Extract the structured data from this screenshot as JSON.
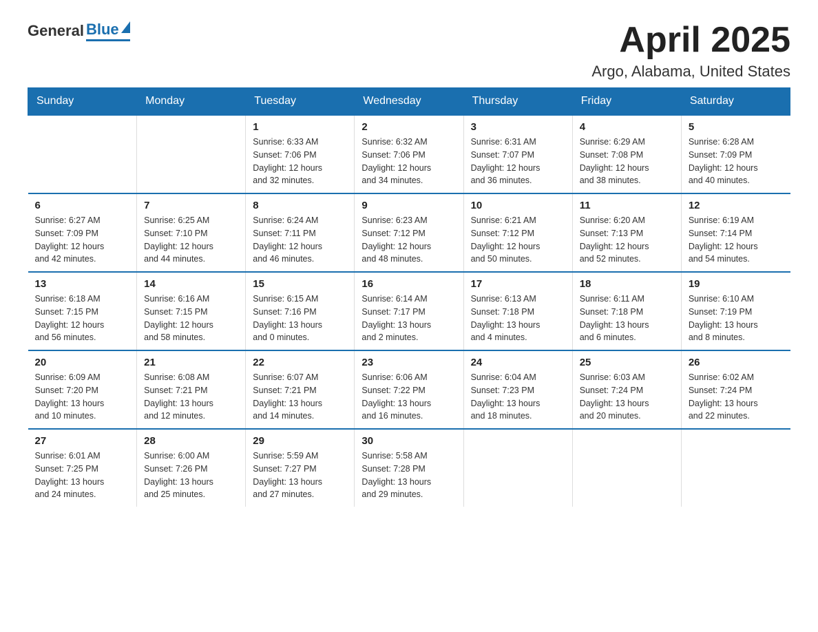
{
  "header": {
    "logo_general": "General",
    "logo_blue": "Blue",
    "month": "April 2025",
    "location": "Argo, Alabama, United States"
  },
  "days_of_week": [
    "Sunday",
    "Monday",
    "Tuesday",
    "Wednesday",
    "Thursday",
    "Friday",
    "Saturday"
  ],
  "weeks": [
    [
      {
        "day": "",
        "info": ""
      },
      {
        "day": "",
        "info": ""
      },
      {
        "day": "1",
        "info": "Sunrise: 6:33 AM\nSunset: 7:06 PM\nDaylight: 12 hours\nand 32 minutes."
      },
      {
        "day": "2",
        "info": "Sunrise: 6:32 AM\nSunset: 7:06 PM\nDaylight: 12 hours\nand 34 minutes."
      },
      {
        "day": "3",
        "info": "Sunrise: 6:31 AM\nSunset: 7:07 PM\nDaylight: 12 hours\nand 36 minutes."
      },
      {
        "day": "4",
        "info": "Sunrise: 6:29 AM\nSunset: 7:08 PM\nDaylight: 12 hours\nand 38 minutes."
      },
      {
        "day": "5",
        "info": "Sunrise: 6:28 AM\nSunset: 7:09 PM\nDaylight: 12 hours\nand 40 minutes."
      }
    ],
    [
      {
        "day": "6",
        "info": "Sunrise: 6:27 AM\nSunset: 7:09 PM\nDaylight: 12 hours\nand 42 minutes."
      },
      {
        "day": "7",
        "info": "Sunrise: 6:25 AM\nSunset: 7:10 PM\nDaylight: 12 hours\nand 44 minutes."
      },
      {
        "day": "8",
        "info": "Sunrise: 6:24 AM\nSunset: 7:11 PM\nDaylight: 12 hours\nand 46 minutes."
      },
      {
        "day": "9",
        "info": "Sunrise: 6:23 AM\nSunset: 7:12 PM\nDaylight: 12 hours\nand 48 minutes."
      },
      {
        "day": "10",
        "info": "Sunrise: 6:21 AM\nSunset: 7:12 PM\nDaylight: 12 hours\nand 50 minutes."
      },
      {
        "day": "11",
        "info": "Sunrise: 6:20 AM\nSunset: 7:13 PM\nDaylight: 12 hours\nand 52 minutes."
      },
      {
        "day": "12",
        "info": "Sunrise: 6:19 AM\nSunset: 7:14 PM\nDaylight: 12 hours\nand 54 minutes."
      }
    ],
    [
      {
        "day": "13",
        "info": "Sunrise: 6:18 AM\nSunset: 7:15 PM\nDaylight: 12 hours\nand 56 minutes."
      },
      {
        "day": "14",
        "info": "Sunrise: 6:16 AM\nSunset: 7:15 PM\nDaylight: 12 hours\nand 58 minutes."
      },
      {
        "day": "15",
        "info": "Sunrise: 6:15 AM\nSunset: 7:16 PM\nDaylight: 13 hours\nand 0 minutes."
      },
      {
        "day": "16",
        "info": "Sunrise: 6:14 AM\nSunset: 7:17 PM\nDaylight: 13 hours\nand 2 minutes."
      },
      {
        "day": "17",
        "info": "Sunrise: 6:13 AM\nSunset: 7:18 PM\nDaylight: 13 hours\nand 4 minutes."
      },
      {
        "day": "18",
        "info": "Sunrise: 6:11 AM\nSunset: 7:18 PM\nDaylight: 13 hours\nand 6 minutes."
      },
      {
        "day": "19",
        "info": "Sunrise: 6:10 AM\nSunset: 7:19 PM\nDaylight: 13 hours\nand 8 minutes."
      }
    ],
    [
      {
        "day": "20",
        "info": "Sunrise: 6:09 AM\nSunset: 7:20 PM\nDaylight: 13 hours\nand 10 minutes."
      },
      {
        "day": "21",
        "info": "Sunrise: 6:08 AM\nSunset: 7:21 PM\nDaylight: 13 hours\nand 12 minutes."
      },
      {
        "day": "22",
        "info": "Sunrise: 6:07 AM\nSunset: 7:21 PM\nDaylight: 13 hours\nand 14 minutes."
      },
      {
        "day": "23",
        "info": "Sunrise: 6:06 AM\nSunset: 7:22 PM\nDaylight: 13 hours\nand 16 minutes."
      },
      {
        "day": "24",
        "info": "Sunrise: 6:04 AM\nSunset: 7:23 PM\nDaylight: 13 hours\nand 18 minutes."
      },
      {
        "day": "25",
        "info": "Sunrise: 6:03 AM\nSunset: 7:24 PM\nDaylight: 13 hours\nand 20 minutes."
      },
      {
        "day": "26",
        "info": "Sunrise: 6:02 AM\nSunset: 7:24 PM\nDaylight: 13 hours\nand 22 minutes."
      }
    ],
    [
      {
        "day": "27",
        "info": "Sunrise: 6:01 AM\nSunset: 7:25 PM\nDaylight: 13 hours\nand 24 minutes."
      },
      {
        "day": "28",
        "info": "Sunrise: 6:00 AM\nSunset: 7:26 PM\nDaylight: 13 hours\nand 25 minutes."
      },
      {
        "day": "29",
        "info": "Sunrise: 5:59 AM\nSunset: 7:27 PM\nDaylight: 13 hours\nand 27 minutes."
      },
      {
        "day": "30",
        "info": "Sunrise: 5:58 AM\nSunset: 7:28 PM\nDaylight: 13 hours\nand 29 minutes."
      },
      {
        "day": "",
        "info": ""
      },
      {
        "day": "",
        "info": ""
      },
      {
        "day": "",
        "info": ""
      }
    ]
  ]
}
